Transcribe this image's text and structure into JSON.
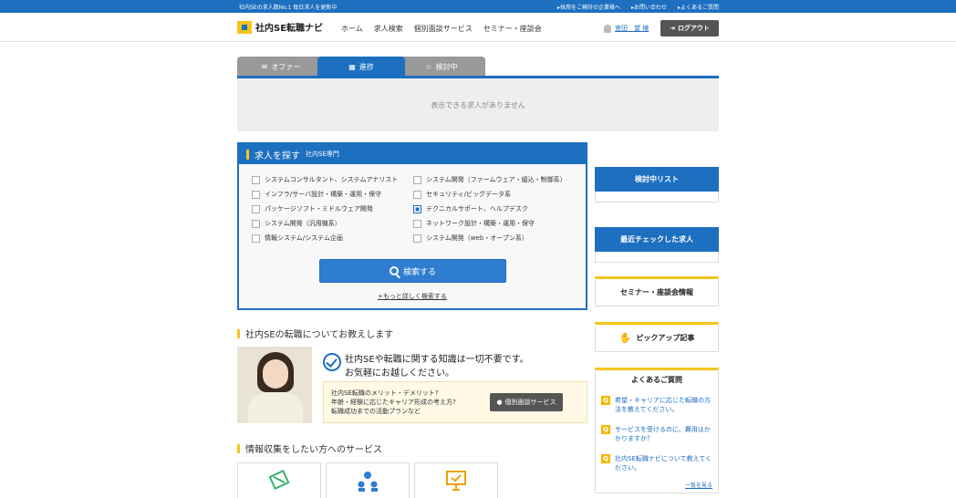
{
  "topbar": {
    "left_text": "社内SEの求人数No.1 毎日求人を更新中",
    "links": [
      "▸採用をご検討の企業様へ",
      "▸お問い合わせ",
      "▸よくあるご質問"
    ]
  },
  "header": {
    "logo_text": "社内SE転職ナビ",
    "nav": [
      "ホーム",
      "求人検索",
      "個別面談サービス",
      "セミナー・座談会"
    ],
    "user_name": "宮田　望 様",
    "logout_label": "ログアウト"
  },
  "tabs": [
    {
      "label": "オファー",
      "icon": "envelope-icon"
    },
    {
      "label": "進捗",
      "icon": "calendar-icon"
    },
    {
      "label": "検討中",
      "icon": "star-icon"
    }
  ],
  "offers": {
    "empty_message": "表示できる求人がありません"
  },
  "search": {
    "title": "求人を探す",
    "subtitle": "社内SE専門",
    "categories": [
      {
        "label": "システムコンサルタント、システムアナリスト",
        "checked": false
      },
      {
        "label": "システム開発（ファームウェア・組込・制御系）",
        "checked": false
      },
      {
        "label": "インフラ/サーバ設計・構築・運用・保守",
        "checked": false
      },
      {
        "label": "セキュリティ/ビッグデータ系",
        "checked": false
      },
      {
        "label": "パッケージソフト・ミドルウェア開発",
        "checked": false
      },
      {
        "label": "テクニカルサポート、ヘルプデスク",
        "checked": true
      },
      {
        "label": "システム開発（汎用機系）",
        "checked": false
      },
      {
        "label": "ネットワーク設計・構築・運用・保守",
        "checked": false
      },
      {
        "label": "情報システム/システム企画",
        "checked": false
      },
      {
        "label": "システム開発（web・オープン系）",
        "checked": false
      }
    ],
    "button_label": "検索する",
    "more_link": "+もっと詳しく検索する"
  },
  "intro": {
    "title": "社内SEの転職についてお教えします",
    "headline1": "社内SEや転職に関する知識は一切不要です。",
    "headline2": "お気軽にお越しください。",
    "lines": [
      "社内SE転職のメリット・デメリット?",
      "年齢・経験に応じたキャリア形成の考え方?",
      "転職成功までの活動プランなど"
    ],
    "consult_label": "個別面談サービス"
  },
  "services": {
    "title": "情報収集をしたい方へのサービス"
  },
  "sidebar": {
    "review_list": "検討中リスト",
    "recent": "最近チェックした求人",
    "seminar": "セミナー・座談会情報",
    "pickup": "ピックアップ記事",
    "faq_title": "よくあるご質問",
    "faq": [
      "希望・キャリアに応じた転職の方法を教えてください。",
      "サービスを受けるのに、費用はかかりますか？",
      "社内SE転職ナビについて教えてください。"
    ],
    "faq_all": "一覧を見る",
    "faq_badge": "Q"
  },
  "colors": {
    "accent": "#1d6fc0",
    "highlight": "#f5c518"
  }
}
